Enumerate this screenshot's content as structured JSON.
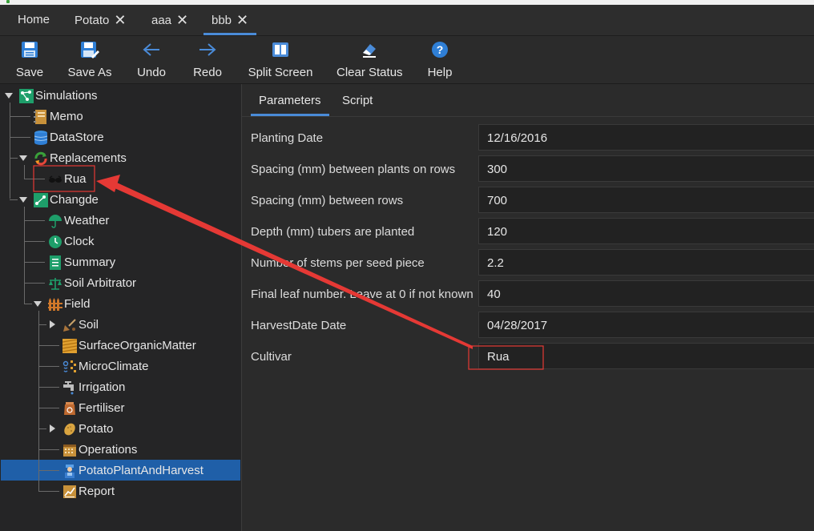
{
  "tabs": [
    {
      "label": "Home",
      "closable": false
    },
    {
      "label": "Potato",
      "closable": true
    },
    {
      "label": "aaa",
      "closable": true
    },
    {
      "label": "bbb",
      "closable": true,
      "active": true
    }
  ],
  "close_glyph": "✕",
  "toolbar": {
    "save": "Save",
    "save_as": "Save As",
    "undo": "Undo",
    "redo": "Redo",
    "split_screen": "Split Screen",
    "clear_status": "Clear Status",
    "help": "Help"
  },
  "tree": {
    "simulations": "Simulations",
    "memo": "Memo",
    "datastore": "DataStore",
    "replacements": "Replacements",
    "rua": "Rua",
    "changde": "Changde",
    "weather": "Weather",
    "clock": "Clock",
    "summary": "Summary",
    "soil_arbitrator": "Soil Arbitrator",
    "field": "Field",
    "soil": "Soil",
    "surface_organic_matter": "SurfaceOrganicMatter",
    "microclimate": "MicroClimate",
    "irrigation": "Irrigation",
    "fertiliser": "Fertiliser",
    "potato": "Potato",
    "operations": "Operations",
    "potato_plant_and_harvest": "PotatoPlantAndHarvest",
    "report": "Report"
  },
  "panel": {
    "tabs": [
      "Parameters",
      "Script"
    ],
    "rows": [
      {
        "label": "Planting Date",
        "value": "12/16/2016"
      },
      {
        "label": "Spacing (mm) between plants on rows",
        "value": "300"
      },
      {
        "label": "Spacing (mm) between rows",
        "value": "700"
      },
      {
        "label": "Depth (mm) tubers are planted",
        "value": "120"
      },
      {
        "label": "Number of stems per seed piece",
        "value": "2.2"
      },
      {
        "label": "Final leaf number.  Leave at 0 if not known",
        "value": "40"
      },
      {
        "label": "HarvestDate Date",
        "value": "04/28/2017"
      },
      {
        "label": "Cultivar",
        "value": "Rua"
      }
    ]
  },
  "colors": {
    "accent": "#4a8bd8",
    "selection": "#1f5fa8",
    "annotation": "#e53935"
  }
}
